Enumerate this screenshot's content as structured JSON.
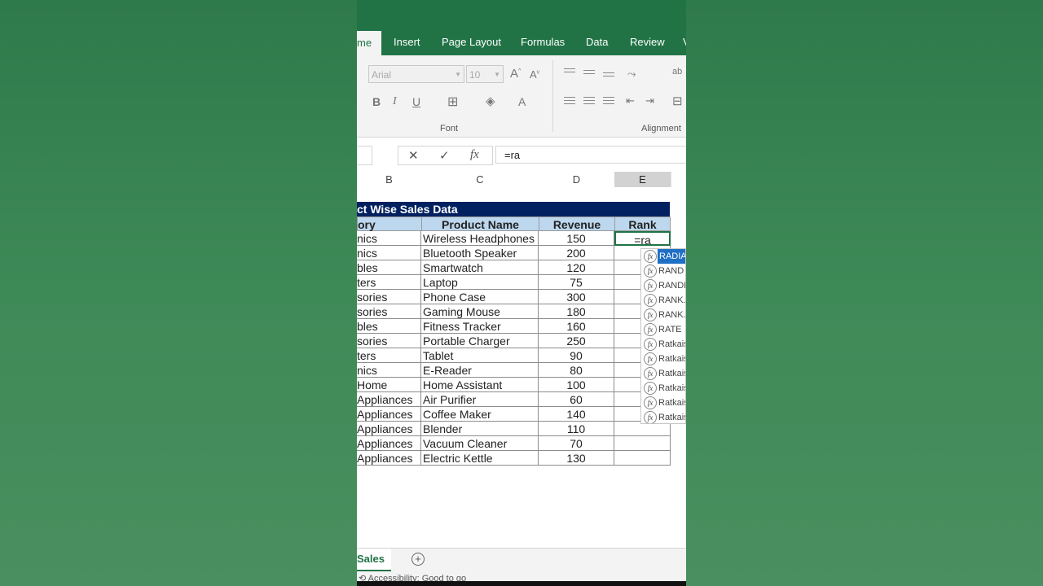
{
  "ribbon": {
    "tabs": [
      "me",
      "Insert",
      "Page Layout",
      "Formulas",
      "Data",
      "Review",
      "V"
    ],
    "font_name": "Arial",
    "font_size": "10",
    "font_group_label": "Font",
    "alignment_group_label": "Alignment"
  },
  "formula_bar": {
    "cancel": "✕",
    "enter": "✓",
    "fx": "fx",
    "content": "=ra"
  },
  "columns": [
    "B",
    "C",
    "D",
    "E"
  ],
  "sheet": {
    "title": "ct Wise Sales Data",
    "headers": {
      "category": "ory",
      "product": "Product Name",
      "revenue": "Revenue",
      "rank": "Rank"
    },
    "rows": [
      {
        "category": "nics",
        "product": "Wireless Headphones",
        "revenue": "150",
        "rank": "=ra"
      },
      {
        "category": "nics",
        "product": "Bluetooth Speaker",
        "revenue": "200",
        "rank": ""
      },
      {
        "category": "bles",
        "product": "Smartwatch",
        "revenue": "120",
        "rank": ""
      },
      {
        "category": "ters",
        "product": "Laptop",
        "revenue": "75",
        "rank": ""
      },
      {
        "category": "sories",
        "product": "Phone Case",
        "revenue": "300",
        "rank": ""
      },
      {
        "category": "sories",
        "product": "Gaming Mouse",
        "revenue": "180",
        "rank": ""
      },
      {
        "category": "bles",
        "product": "Fitness Tracker",
        "revenue": "160",
        "rank": ""
      },
      {
        "category": "sories",
        "product": "Portable Charger",
        "revenue": "250",
        "rank": ""
      },
      {
        "category": "ters",
        "product": "Tablet",
        "revenue": "90",
        "rank": ""
      },
      {
        "category": "nics",
        "product": "E-Reader",
        "revenue": "80",
        "rank": ""
      },
      {
        "category": "Home",
        "product": "Home Assistant",
        "revenue": "100",
        "rank": ""
      },
      {
        "category": "Appliances",
        "product": "Air Purifier",
        "revenue": "60",
        "rank": ""
      },
      {
        "category": "Appliances",
        "product": "Coffee Maker",
        "revenue": "140",
        "rank": ""
      },
      {
        "category": "Appliances",
        "product": "Blender",
        "revenue": "110",
        "rank": ""
      },
      {
        "category": "Appliances",
        "product": "Vacuum Cleaner",
        "revenue": "70",
        "rank": ""
      },
      {
        "category": "Appliances",
        "product": "Electric Kettle",
        "revenue": "130",
        "rank": ""
      }
    ]
  },
  "autocomplete": {
    "items": [
      "RADIA",
      "RAND",
      "RANDI",
      "RANK.",
      "RANK.",
      "RATE",
      "Ratkais",
      "Ratkais",
      "Ratkais",
      "Ratkais",
      "Ratkais",
      "Ratkais"
    ],
    "highlighted_index": 0
  },
  "sheet_tabs": {
    "active": "Sales",
    "add": "+"
  },
  "status": {
    "accessibility": "Accessibility: Good to go"
  }
}
